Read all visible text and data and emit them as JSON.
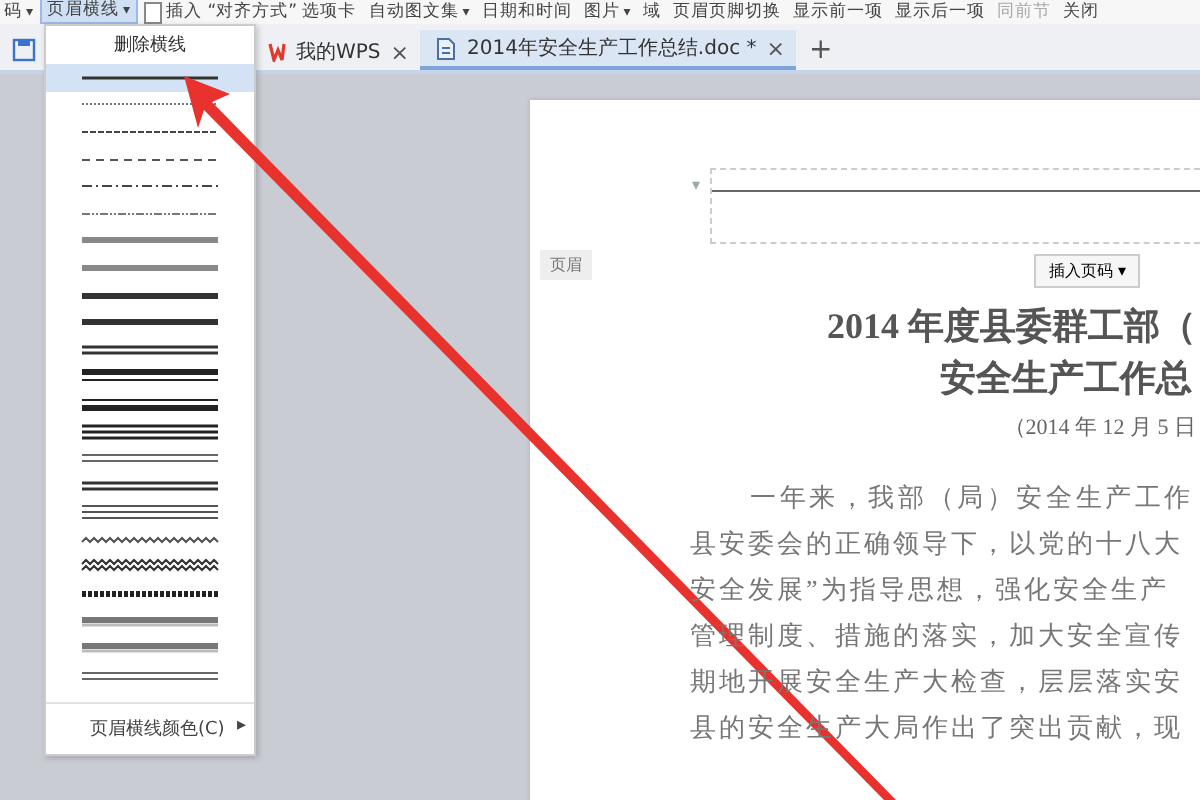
{
  "toolbar": {
    "items": [
      {
        "kind": "button",
        "label": "码",
        "arrow": "▾",
        "selected": false,
        "disabled": false
      },
      {
        "kind": "button",
        "label": "页眉横线",
        "arrow": "▾",
        "selected": true,
        "disabled": false
      },
      {
        "kind": "icon-button",
        "label": "插入 “对齐方式” 选项卡",
        "selected": false,
        "disabled": false
      },
      {
        "kind": "button",
        "label": "自动图文集",
        "arrow": "▾",
        "selected": false,
        "disabled": false
      },
      {
        "kind": "button",
        "label": "日期和时间",
        "selected": false,
        "disabled": false
      },
      {
        "kind": "button",
        "label": "图片",
        "arrow": "▾",
        "selected": false,
        "disabled": false
      },
      {
        "kind": "button",
        "label": "域",
        "selected": false,
        "disabled": false
      },
      {
        "kind": "button",
        "label": "页眉页脚切换",
        "selected": false,
        "disabled": false
      },
      {
        "kind": "button",
        "label": "显示前一项",
        "selected": false,
        "disabled": false
      },
      {
        "kind": "button",
        "label": "显示后一项",
        "selected": false,
        "disabled": false
      },
      {
        "kind": "button",
        "label": "同前节",
        "selected": false,
        "disabled": true
      },
      {
        "kind": "button",
        "label": "关闭",
        "selected": false,
        "disabled": false
      }
    ]
  },
  "tabs": [
    {
      "kind": "home",
      "label": "我的WPS",
      "selected": false,
      "close": "×"
    },
    {
      "kind": "document",
      "label": "2014年安全生产工作总结.doc *",
      "selected": true,
      "close": "×"
    }
  ],
  "new_tab": "+",
  "menu": {
    "header": "删除横线",
    "line_styles": [
      {
        "kind": "solid",
        "selected": true
      },
      {
        "kind": "dotted",
        "selected": false
      },
      {
        "kind": "dashed-small",
        "selected": false
      },
      {
        "kind": "dashed",
        "selected": false
      },
      {
        "kind": "dash-dot",
        "selected": false
      },
      {
        "kind": "dash-dot-dot",
        "selected": false
      },
      {
        "kind": "thick-gray",
        "selected": false
      },
      {
        "kind": "thick-gray",
        "selected": false
      },
      {
        "kind": "thick",
        "selected": false
      },
      {
        "kind": "thick",
        "selected": false
      },
      {
        "kind": "double",
        "selected": false
      },
      {
        "kind": "thick-thin",
        "selected": false
      },
      {
        "kind": "thin-thick",
        "selected": false
      },
      {
        "kind": "triple",
        "selected": false
      },
      {
        "kind": "double-gray",
        "selected": false
      },
      {
        "kind": "double",
        "selected": false
      },
      {
        "kind": "triple-thin",
        "selected": false
      },
      {
        "kind": "wave",
        "selected": false
      },
      {
        "kind": "double-wave",
        "selected": false
      },
      {
        "kind": "striped",
        "selected": false
      },
      {
        "kind": "embossed",
        "selected": false
      },
      {
        "kind": "embossed",
        "selected": false
      },
      {
        "kind": "double-gray",
        "selected": false
      }
    ],
    "footer": "页眉横线颜色(C)",
    "footer_arrow": "▸"
  },
  "document": {
    "header_dropdown": "▾",
    "header_label": "页眉",
    "insert_page_number": "插入页码 ▾",
    "title_lines": [
      "2014 年度县委群工部（",
      "安全生产工作总"
    ],
    "date": "（2014 年 12 月 5 日",
    "paragraph_lines": [
      "一年来，我部（局）安全生产工作",
      "县安委会的正确领导下，以党的十八大",
      "安全发展”为指导思想，强化安全生产",
      "管理制度、措施的落实，加大安全宣传",
      "期地开展安全生产大检查，层层落实安",
      "县的安全生产大局作出了突出贡献，现"
    ]
  }
}
